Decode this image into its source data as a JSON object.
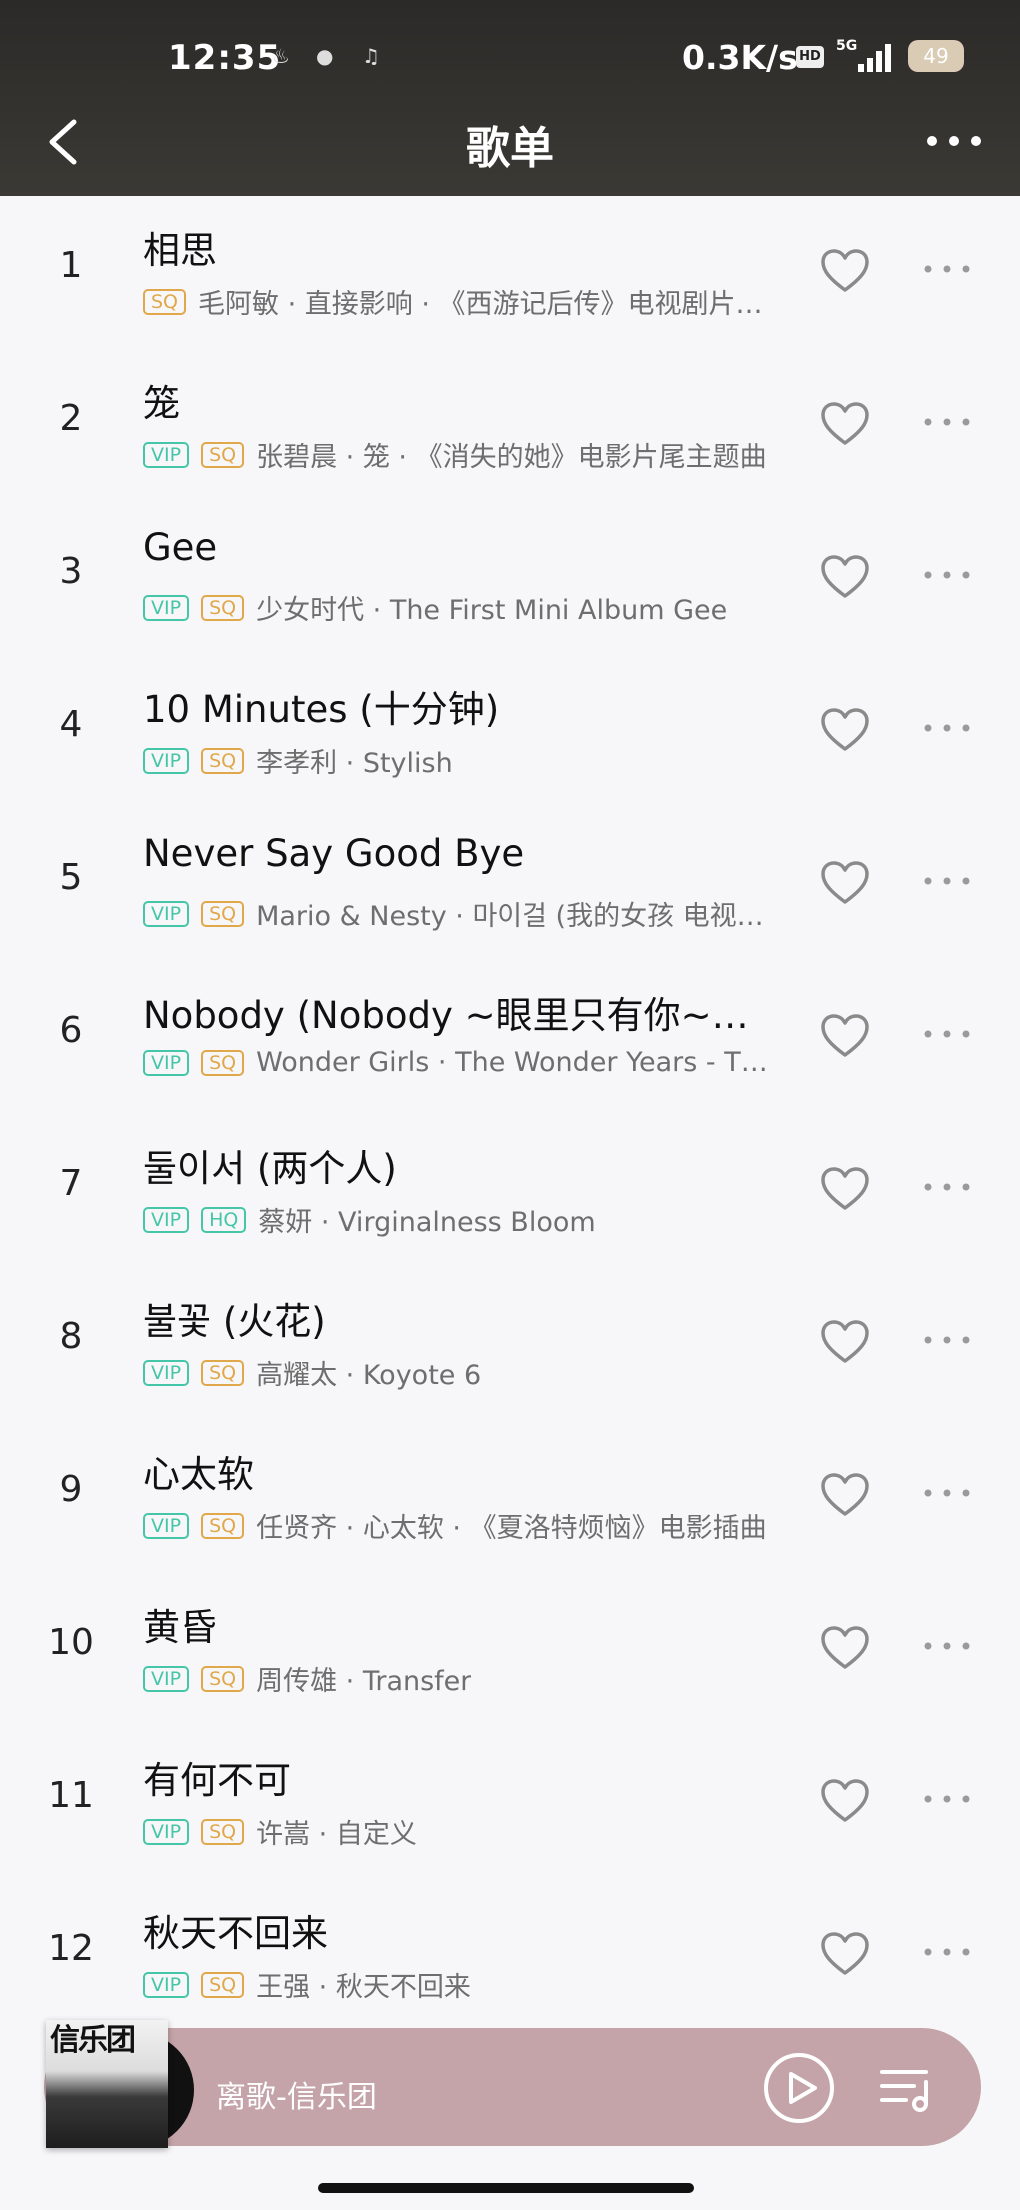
{
  "status_bar": {
    "time": "12:35",
    "network_speed": "0.3K/s",
    "hd": "HD",
    "network_type": "5G",
    "battery": "49"
  },
  "header": {
    "title": "歌单"
  },
  "songs": [
    {
      "rank": "1",
      "title": "相思",
      "badges": [
        "SQ"
      ],
      "meta": "毛阿敏 · 直接影响 · 《西游记后传》电视剧片…"
    },
    {
      "rank": "2",
      "title": "笼",
      "badges": [
        "VIP",
        "SQ"
      ],
      "meta": "张碧晨 · 笼 · 《消失的她》电影片尾主题曲"
    },
    {
      "rank": "3",
      "title": "Gee",
      "badges": [
        "VIP",
        "SQ"
      ],
      "meta": "少女时代 · The First Mini Album Gee"
    },
    {
      "rank": "4",
      "title": "10 Minutes (十分钟)",
      "badges": [
        "VIP",
        "SQ"
      ],
      "meta": "李孝利 · Stylish"
    },
    {
      "rank": "5",
      "title": "Never Say Good Bye",
      "badges": [
        "VIP",
        "SQ"
      ],
      "meta": "Mario & Nesty · 마이걸 (我的女孩 电视…"
    },
    {
      "rank": "6",
      "title": "Nobody (Nobody ~眼里只有你~…",
      "badges": [
        "VIP",
        "SQ"
      ],
      "meta": "Wonder Girls · The Wonder Years - T…"
    },
    {
      "rank": "7",
      "title": "둘이서 (两个人)",
      "badges": [
        "VIP",
        "HQ"
      ],
      "meta": "蔡妍 · Virginalness Bloom"
    },
    {
      "rank": "8",
      "title": "불꽃 (火花)",
      "badges": [
        "VIP",
        "SQ"
      ],
      "meta": "高耀太 · Koyote 6"
    },
    {
      "rank": "9",
      "title": "心太软",
      "badges": [
        "VIP",
        "SQ"
      ],
      "meta": "任贤齐 · 心太软 · 《夏洛特烦恼》电影插曲"
    },
    {
      "rank": "10",
      "title": "黄昏",
      "badges": [
        "VIP",
        "SQ"
      ],
      "meta": "周传雄 · Transfer"
    },
    {
      "rank": "11",
      "title": "有何不可",
      "badges": [
        "VIP",
        "SQ"
      ],
      "meta": "许嵩 · 自定义"
    },
    {
      "rank": "12",
      "title": "秋天不回来",
      "badges": [
        "VIP",
        "SQ"
      ],
      "meta": "王强 · 秋天不回来"
    }
  ],
  "player": {
    "now_playing": "离歌-信乐团",
    "cover_text": "信乐团"
  },
  "icons": {
    "back": "chevron-left-icon",
    "more": "more-dots-icon",
    "heart": "heart-outline-icon",
    "play": "play-circle-icon",
    "queue": "playlist-icon"
  },
  "colors": {
    "header_bg": "#2b2a28",
    "vip": "#45c6a8",
    "sq": "#e0a84a",
    "player_bg": "#c4a4a8"
  }
}
